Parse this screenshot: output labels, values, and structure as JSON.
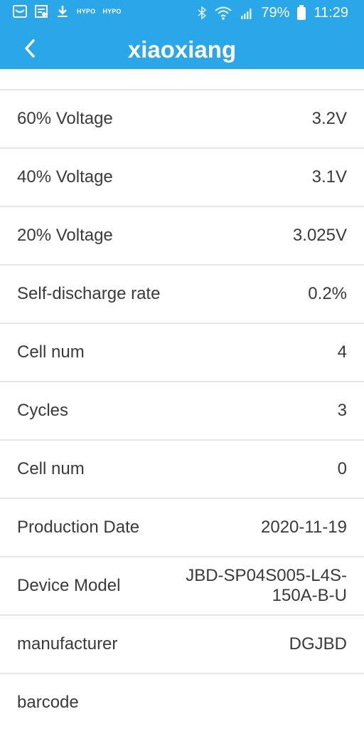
{
  "status_bar": {
    "left_icons": [
      "mail-icon",
      "calendar-icon",
      "download-icon"
    ],
    "mini_labels": [
      "HYPO",
      "HYPO"
    ],
    "battery_percent": "79%",
    "time": "11:29"
  },
  "header": {
    "title": "xiaoxiang",
    "back_icon": "chevron-left-icon",
    "accent_color": "#2aa7e8"
  },
  "list": [
    {
      "label": "60% Voltage",
      "value": "3.2V"
    },
    {
      "label": "40% Voltage",
      "value": "3.1V"
    },
    {
      "label": "20% Voltage",
      "value": "3.025V"
    },
    {
      "label": "Self-discharge rate",
      "value": "0.2%"
    },
    {
      "label": "Cell num",
      "value": "4"
    },
    {
      "label": "Cycles",
      "value": "3"
    },
    {
      "label": "Cell num",
      "value": "0"
    },
    {
      "label": "Production Date",
      "value": "2020-11-19"
    },
    {
      "label": "Device Model",
      "value": "JBD-SP04S005-L4S-150A-B-U"
    },
    {
      "label": "manufacturer",
      "value": "DGJBD"
    },
    {
      "label": "barcode",
      "value": ""
    }
  ]
}
